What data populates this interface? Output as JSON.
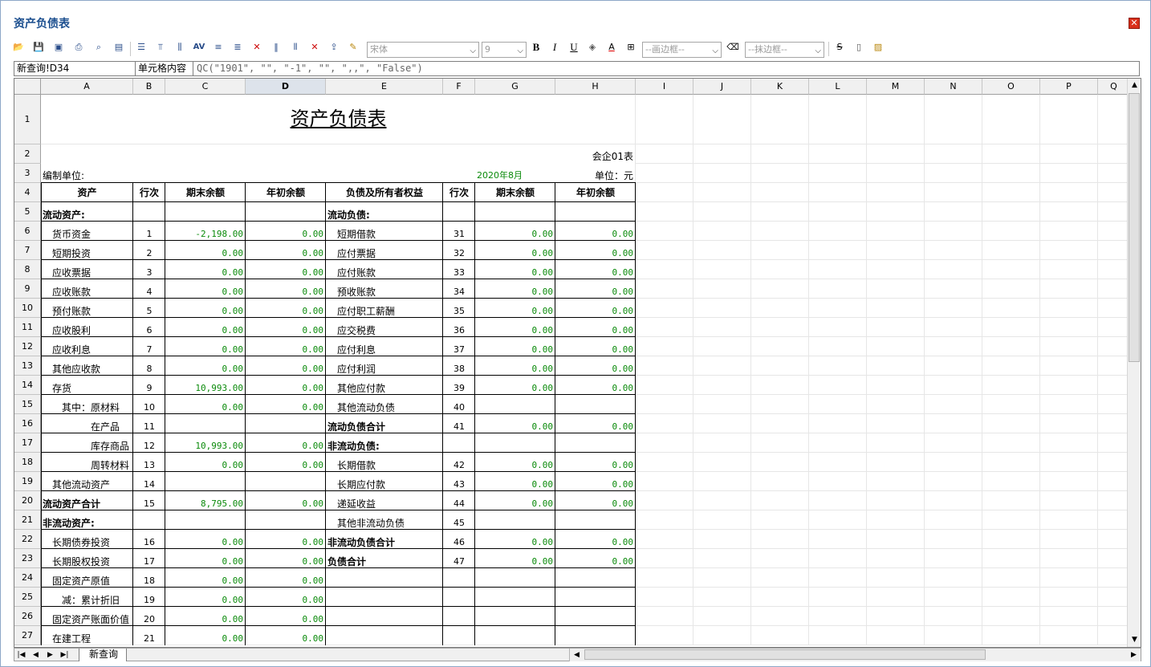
{
  "window": {
    "title": "资产负债表",
    "close_icon": "close-icon"
  },
  "toolbar": {
    "font_name": "宋体",
    "font_size": "9",
    "bold_label": "B",
    "italic_label": "I",
    "underline_label": "U",
    "border_combo": "--画边框--",
    "erase_border_combo": "--抹边框--"
  },
  "formula_bar": {
    "cell_ref": "新查询!D34",
    "label": "单元格内容",
    "formula": "QC(\"1901\", \"\", \"-1\", \"\", \",,\", \"False\")"
  },
  "columns": [
    "A",
    "B",
    "C",
    "D",
    "E",
    "F",
    "G",
    "H",
    "I",
    "J",
    "K",
    "L",
    "M",
    "N",
    "O",
    "P",
    "Q"
  ],
  "selected_column": "D",
  "rows": [
    "1",
    "2",
    "3",
    "4",
    "5",
    "6",
    "7",
    "8",
    "9",
    "10",
    "11",
    "12",
    "13",
    "14",
    "15",
    "16",
    "17",
    "18",
    "19",
    "20",
    "21",
    "22",
    "23",
    "24",
    "25",
    "26",
    "27"
  ],
  "report": {
    "title": "资产负债表",
    "form_code": "会企01表",
    "unit_label": "编制单位:",
    "period": "2020年8月",
    "currency": "单位：元",
    "headers": [
      "资产",
      "行次",
      "期末余额",
      "年初余额",
      "负债及所有者权益",
      "行次",
      "期末余额",
      "年初余额"
    ],
    "lines": [
      {
        "a": "流动资产:",
        "a_bold": true,
        "b": "",
        "c": "",
        "d": "",
        "e": "流动负债:",
        "e_bold": true,
        "f": "",
        "g": "",
        "h": ""
      },
      {
        "a": "货币资金",
        "a_indent": 1,
        "b": "1",
        "c": "-2,198.00",
        "d": "0.00",
        "e": "短期借款",
        "e_indent": 1,
        "f": "31",
        "g": "0.00",
        "h": "0.00"
      },
      {
        "a": "短期投资",
        "a_indent": 1,
        "b": "2",
        "c": "0.00",
        "d": "0.00",
        "e": "应付票据",
        "e_indent": 1,
        "f": "32",
        "g": "0.00",
        "h": "0.00"
      },
      {
        "a": "应收票据",
        "a_indent": 1,
        "b": "3",
        "c": "0.00",
        "d": "0.00",
        "e": "应付账款",
        "e_indent": 1,
        "f": "33",
        "g": "0.00",
        "h": "0.00"
      },
      {
        "a": "应收账款",
        "a_indent": 1,
        "b": "4",
        "c": "0.00",
        "d": "0.00",
        "e": "预收账款",
        "e_indent": 1,
        "f": "34",
        "g": "0.00",
        "h": "0.00"
      },
      {
        "a": "预付账款",
        "a_indent": 1,
        "b": "5",
        "c": "0.00",
        "d": "0.00",
        "e": "应付职工薪酬",
        "e_indent": 1,
        "f": "35",
        "g": "0.00",
        "h": "0.00"
      },
      {
        "a": "应收股利",
        "a_indent": 1,
        "b": "6",
        "c": "0.00",
        "d": "0.00",
        "e": "应交税费",
        "e_indent": 1,
        "f": "36",
        "g": "0.00",
        "h": "0.00"
      },
      {
        "a": "应收利息",
        "a_indent": 1,
        "b": "7",
        "c": "0.00",
        "d": "0.00",
        "e": "应付利息",
        "e_indent": 1,
        "f": "37",
        "g": "0.00",
        "h": "0.00"
      },
      {
        "a": "其他应收款",
        "a_indent": 1,
        "b": "8",
        "c": "0.00",
        "d": "0.00",
        "e": "应付利润",
        "e_indent": 1,
        "f": "38",
        "g": "0.00",
        "h": "0.00"
      },
      {
        "a": "存货",
        "a_indent": 1,
        "b": "9",
        "c": "10,993.00",
        "d": "0.00",
        "e": "其他应付款",
        "e_indent": 1,
        "f": "39",
        "g": "0.00",
        "h": "0.00"
      },
      {
        "a": "其中：原材料",
        "a_indent": 2,
        "b": "10",
        "c": "0.00",
        "d": "0.00",
        "e": "其他流动负债",
        "e_indent": 1,
        "f": "40",
        "g": "",
        "h": ""
      },
      {
        "a": "在产品",
        "a_indent": 3,
        "b": "11",
        "c": "",
        "d": "",
        "e": "流动负债合计",
        "e_bold": true,
        "f": "41",
        "g": "0.00",
        "h": "0.00"
      },
      {
        "a": "库存商品",
        "a_indent": 3,
        "b": "12",
        "c": "10,993.00",
        "d": "0.00",
        "e": "非流动负债:",
        "e_bold": true,
        "f": "",
        "g": "",
        "h": ""
      },
      {
        "a": "周转材料",
        "a_indent": 3,
        "b": "13",
        "c": "0.00",
        "d": "0.00",
        "e": "长期借款",
        "e_indent": 1,
        "f": "42",
        "g": "0.00",
        "h": "0.00"
      },
      {
        "a": "其他流动资产",
        "a_indent": 1,
        "b": "14",
        "c": "",
        "d": "",
        "e": "长期应付款",
        "e_indent": 1,
        "f": "43",
        "g": "0.00",
        "h": "0.00"
      },
      {
        "a": "流动资产合计",
        "a_bold": true,
        "b": "15",
        "c": "8,795.00",
        "d": "0.00",
        "e": "递延收益",
        "e_indent": 1,
        "f": "44",
        "g": "0.00",
        "h": "0.00"
      },
      {
        "a": "非流动资产:",
        "a_bold": true,
        "b": "",
        "c": "",
        "d": "",
        "e": "其他非流动负债",
        "e_indent": 1,
        "f": "45",
        "g": "",
        "h": ""
      },
      {
        "a": "长期债券投资",
        "a_indent": 1,
        "b": "16",
        "c": "0.00",
        "d": "0.00",
        "e": "非流动负债合计",
        "e_bold": true,
        "f": "46",
        "g": "0.00",
        "h": "0.00"
      },
      {
        "a": "长期股权投资",
        "a_indent": 1,
        "b": "17",
        "c": "0.00",
        "d": "0.00",
        "e": "负债合计",
        "e_bold": true,
        "f": "47",
        "g": "0.00",
        "h": "0.00"
      },
      {
        "a": "固定资产原值",
        "a_indent": 1,
        "b": "18",
        "c": "0.00",
        "d": "0.00",
        "e": "",
        "f": "",
        "g": "",
        "h": ""
      },
      {
        "a": "减：累计折旧",
        "a_indent": 2,
        "b": "19",
        "c": "0.00",
        "d": "0.00",
        "e": "",
        "f": "",
        "g": "",
        "h": ""
      },
      {
        "a": "固定资产账面价值",
        "a_indent": 1,
        "b": "20",
        "c": "0.00",
        "d": "0.00",
        "e": "",
        "f": "",
        "g": "",
        "h": ""
      },
      {
        "a": "在建工程",
        "a_indent": 1,
        "b": "21",
        "c": "0.00",
        "d": "0.00",
        "e": "",
        "f": "",
        "g": "",
        "h": ""
      }
    ]
  },
  "sheet_tabs": [
    "新查询"
  ],
  "colors": {
    "title": "#1c4f8f",
    "number": "#0a8a0a",
    "header_bg": "#f0f0f0"
  }
}
